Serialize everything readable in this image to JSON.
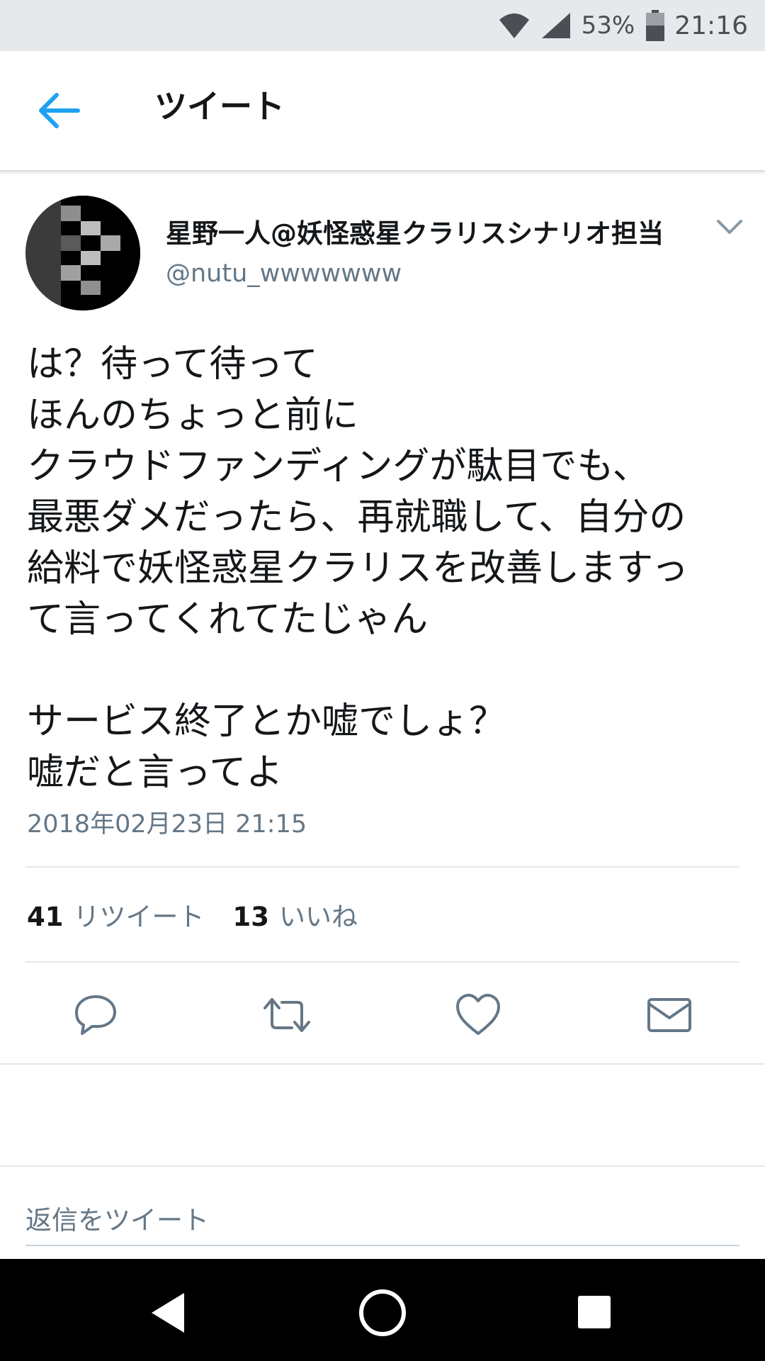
{
  "status_bar": {
    "battery": "53%",
    "time": "21:16",
    "icons": [
      "wifi-icon",
      "cell-signal-icon",
      "battery-icon"
    ]
  },
  "header": {
    "back_icon": "arrow-left-icon",
    "title": "ツイート"
  },
  "tweet": {
    "author_name": "星野一人@妖怪惑星クラリスシナリオ担当",
    "handle": "@nutu_wwwwwww",
    "text": "は？待って待って\nほんのちょっと前に\nクラウドファンディングが駄目でも、\n最悪ダメだったら、再就職して、自分の\n給料で妖怪惑星クラリスを改善しますっ\nて言ってくれてたじゃん\n\nサービス終了とか嘘でしょ？\n嘘だと言ってよ",
    "timestamp": "2018年02月23日 21:15",
    "retweet_count": "41",
    "retweet_label": "リツイート",
    "like_count": "13",
    "like_label": "いいね"
  },
  "actions": [
    "reply-icon",
    "retweet-icon",
    "like-icon",
    "direct-message-icon"
  ],
  "reply": {
    "placeholder": "返信をツイート"
  },
  "colors": {
    "accent": "#1da1f2",
    "secondary_text": "#657786",
    "primary_text": "#14171a",
    "status_bar_bg": "#e6e9ec"
  }
}
